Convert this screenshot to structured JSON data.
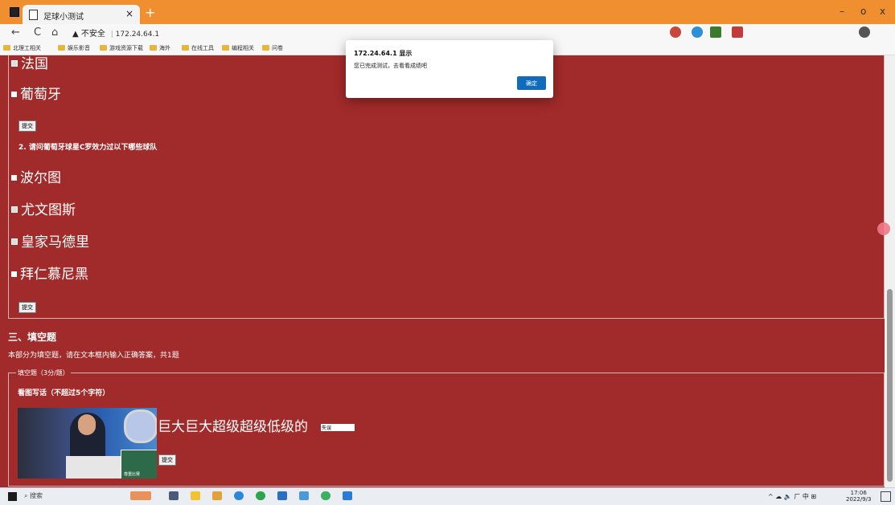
{
  "browser": {
    "tab_title": "足球小测试",
    "tab_close": "×",
    "new_tab": "+",
    "url_warning": "▲ 不安全",
    "url": "172.24.64.1",
    "window_controls": {
      "minimize": "–",
      "maximize": "o",
      "close": "x"
    },
    "nav": {
      "back": "←",
      "refresh": "C",
      "home": "⌂"
    },
    "bookmarks": [
      "北理工相关",
      "娱乐影音",
      "游戏资源下载",
      "海外",
      "在线工具",
      "编程相关",
      "问卷"
    ]
  },
  "content": {
    "q1_options": [
      {
        "label": "法国",
        "checked": true
      },
      {
        "label": "葡萄牙",
        "checked": false
      }
    ],
    "submit_label": "提交",
    "q2": {
      "title": "2. 请问葡萄牙球星C罗效力过以下哪些球队",
      "options": [
        {
          "label": "波尔图",
          "checked": false
        },
        {
          "label": "尤文图斯",
          "checked": true
        },
        {
          "label": "皇家马德里",
          "checked": true
        },
        {
          "label": "拜仁慕尼黑",
          "checked": false
        }
      ]
    },
    "section3": {
      "heading": "三、填空题",
      "description": "本部分为填空题，请在文本框内输入正确答案，共1题",
      "legend": "填空题（3分/题）",
      "question_title": "看图写话（不超过5个字符）",
      "sentence": "巨大巨大超级超级低级的",
      "input_value": "失误",
      "image_caption": "尊重比赛"
    }
  },
  "dialog": {
    "title": "172.24.64.1 显示",
    "message": "您已完成测试，去看看成绩吧",
    "ok_label": "确定"
  },
  "taskbar": {
    "search_placeholder": "搜索",
    "tray": "^ ☁ 🔈 ㄏ 中 ⊞",
    "time": "17:06",
    "date": "2022/9/3"
  }
}
